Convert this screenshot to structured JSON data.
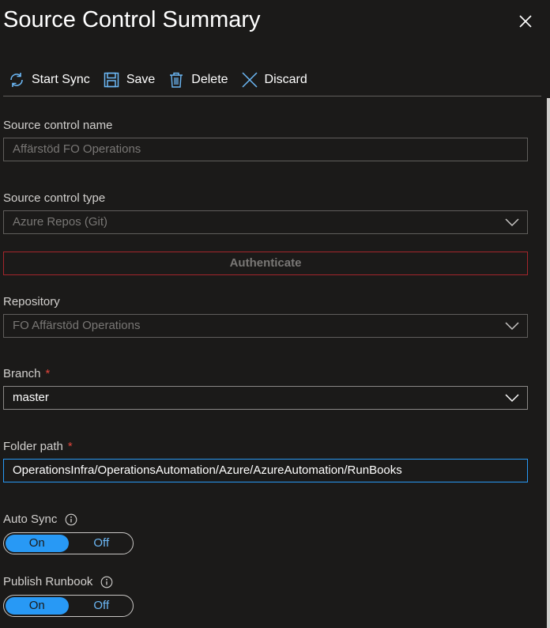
{
  "header": {
    "title": "Source Control Summary"
  },
  "toolbar": {
    "start_sync": "Start Sync",
    "save": "Save",
    "delete": "Delete",
    "discard": "Discard"
  },
  "form": {
    "name": {
      "label": "Source control name",
      "value": "Affärstöd FO Operations"
    },
    "type": {
      "label": "Source control type",
      "value": "Azure Repos (Git)"
    },
    "authenticate": "Authenticate",
    "repository": {
      "label": "Repository",
      "value": "FO Affärstöd Operations"
    },
    "branch": {
      "label": "Branch",
      "required": "*",
      "value": "master"
    },
    "folder": {
      "label": "Folder path",
      "required": "*",
      "value": "OperationsInfra/OperationsAutomation/Azure/AzureAutomation/RunBooks"
    },
    "auto_sync": {
      "label": "Auto Sync",
      "on": "On",
      "off": "Off",
      "selected": "On"
    },
    "publish": {
      "label": "Publish Runbook",
      "on": "On",
      "off": "Off",
      "selected": "On"
    }
  },
  "colors": {
    "accent": "#2899f5",
    "error": "#e0453b",
    "background": "#1b1a19"
  }
}
